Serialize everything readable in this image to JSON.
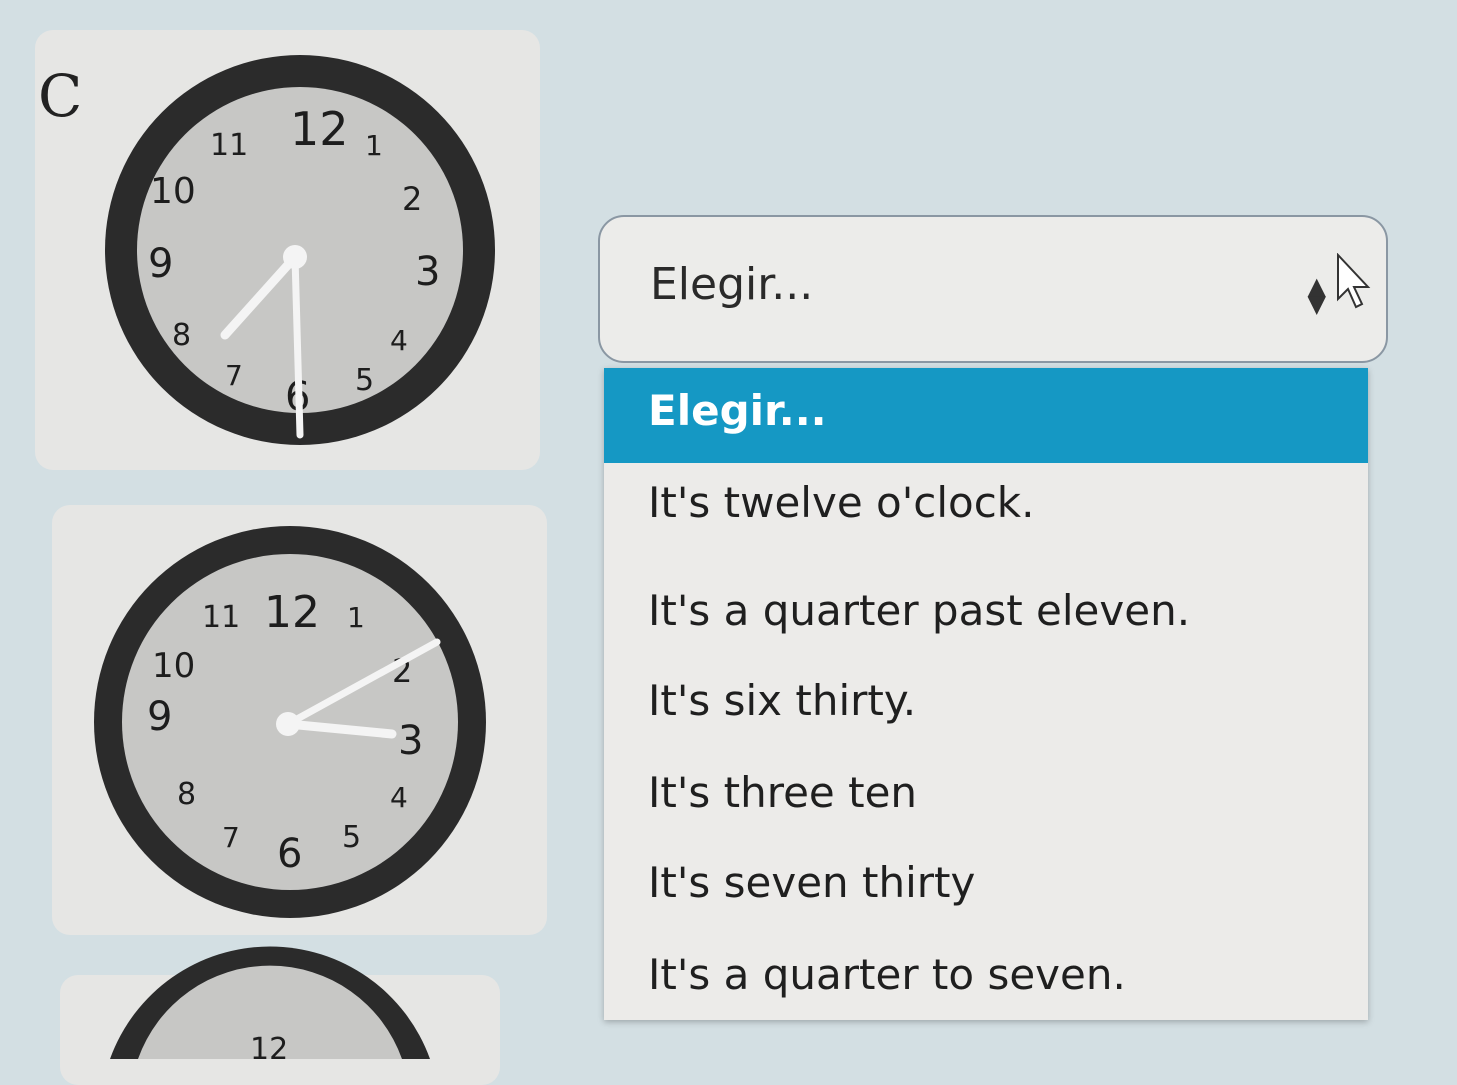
{
  "question": {
    "item_letter": "C"
  },
  "clocks": [
    {
      "numbers": [
        "12",
        "1",
        "2",
        "3",
        "4",
        "5",
        "6",
        "7",
        "8",
        "9",
        "10",
        "11"
      ]
    },
    {
      "numbers": [
        "12",
        "1",
        "2",
        "3",
        "4",
        "5",
        "6",
        "7",
        "8",
        "9",
        "10",
        "11"
      ]
    },
    {
      "numbers": [
        "12"
      ]
    }
  ],
  "select": {
    "value": "Elegir...",
    "arrows_icon": "sort-arrows-icon",
    "cursor_icon": "mouse-pointer-icon"
  },
  "dropdown": {
    "options": [
      "Elegir...",
      "It's twelve o'clock.",
      "It's a quarter past eleven.",
      "It's six thirty.",
      "It's three ten",
      "It's seven thirty",
      "It's a quarter to seven."
    ],
    "highlight_color": "#1598c4"
  }
}
